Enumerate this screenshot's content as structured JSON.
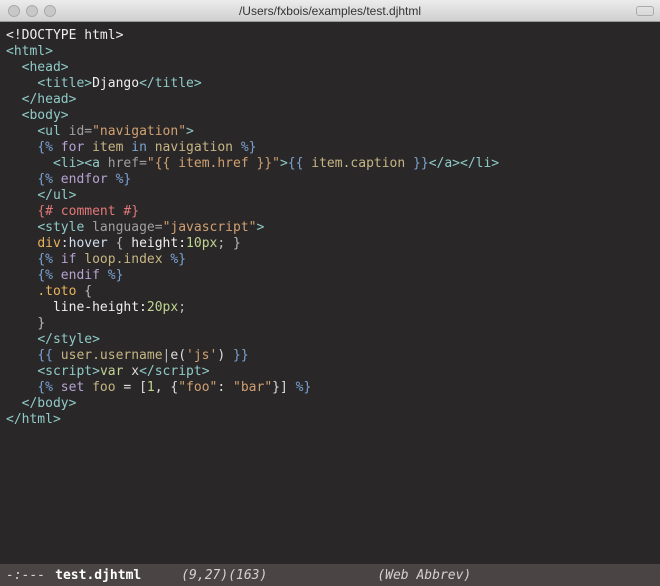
{
  "titlebar": {
    "path": "/Users/fxbois/examples/test.djhtml"
  },
  "modeline": {
    "left": "-:---",
    "file": "test.djhtml",
    "pos": "(9,27)(163)",
    "mode": "(Web Abbrev)"
  },
  "code": {
    "l1": "<!DOCTYPE html>",
    "l2": "<html>",
    "l3_pre": "  ",
    "l3": "<head>",
    "l4_pre": "    ",
    "l4a": "<title>",
    "l4b": "Django",
    "l4c": "</title>",
    "l5_pre": "  ",
    "l5": "</head>",
    "l6_pre": "  ",
    "l6": "<body>",
    "l7_pre": "    ",
    "l7a": "<ul",
    "l7b": " id=",
    "l7c": "\"navigation\"",
    "l7d": ">",
    "l8_pre": "    ",
    "l8a": "{%",
    "l8b": " for ",
    "l8c": "item",
    "l8d": " in ",
    "l8e": "navigation",
    "l8f": " %}",
    "l9_pre": "      ",
    "l9a": "<li><a",
    "l9b": " href=",
    "l9c": "\"{{ item.href }}\"",
    "l9d": ">",
    "l9e": "{{",
    "l9f": " item.caption ",
    "l9g": "}}",
    "l9h": "</a></li>",
    "l10_pre": "    ",
    "l10a": "{%",
    "l10b": " endfor ",
    "l10c": "%}",
    "l11_pre": "    ",
    "l11": "</ul>",
    "l12_pre": "    ",
    "l12": "{# comment #}",
    "l13_pre": "    ",
    "l13a": "<style",
    "l13b": " language=",
    "l13c": "\"javascript\"",
    "l13d": ">",
    "l14_pre": "    ",
    "l14a": "div",
    "l14b": ":hover",
    "l14c": " { ",
    "l14d": "height:",
    "l14e": "10px",
    "l14f": "; }",
    "l15_pre": "    ",
    "l15a": "{%",
    "l15b": " if ",
    "l15c": "loop.index",
    "l15d": " %}",
    "l16_pre": "    ",
    "l16a": "{%",
    "l16b": " endif ",
    "l16c": "%}",
    "l17_pre": "    ",
    "l17a": ".toto",
    "l17b": " {",
    "l18_pre": "      ",
    "l18a": "line-height:",
    "l18b": "20px",
    "l18c": ";",
    "l19_pre": "    ",
    "l19": "}",
    "l20_pre": "    ",
    "l20": "</style>",
    "l21_pre": "    ",
    "l21a": "{{",
    "l21b": " user.username",
    "l21c": "|",
    "l21d": "e(",
    "l21e": "'js'",
    "l21f": ") ",
    "l21g": "}}",
    "l22_pre": "    ",
    "l22a": "<script>",
    "l22b": "var",
    "l22c": " x",
    "l22d": "</scr",
    "l22e": "ipt>",
    "l23_pre": "    ",
    "l23a": "{%",
    "l23b": " set ",
    "l23c": "foo",
    "l23d": " = [",
    "l23e": "1",
    "l23f": ", {",
    "l23g": "\"foo\"",
    "l23h": ": ",
    "l23i": "\"bar\"",
    "l23j": "}] ",
    "l23k": "%}",
    "l24_pre": "  ",
    "l24": "</body>",
    "l25": "</html>"
  }
}
